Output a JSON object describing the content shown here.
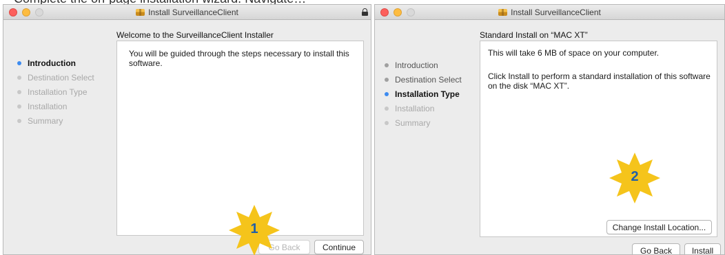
{
  "top_strip_text": "Complete the on-page installation wizard. Navigate…",
  "window1": {
    "title": "Install SurveillanceClient",
    "heading": "Welcome to the SurveillanceClient Installer",
    "steps": [
      {
        "label": "Introduction",
        "state": "active"
      },
      {
        "label": "Destination Select",
        "state": "pending"
      },
      {
        "label": "Installation Type",
        "state": "pending"
      },
      {
        "label": "Installation",
        "state": "pending"
      },
      {
        "label": "Summary",
        "state": "pending"
      }
    ],
    "body": "You will be guided through the steps necessary to install this software.",
    "back_label": "Go Back",
    "continue_label": "Continue",
    "marker": "1"
  },
  "window2": {
    "title": "Install SurveillanceClient",
    "heading": "Standard Install on “MAC XT”",
    "steps": [
      {
        "label": "Introduction",
        "state": "done"
      },
      {
        "label": "Destination Select",
        "state": "done"
      },
      {
        "label": "Installation Type",
        "state": "active"
      },
      {
        "label": "Installation",
        "state": "pending"
      },
      {
        "label": "Summary",
        "state": "pending"
      }
    ],
    "body_line1": "This will take 6 MB of space on your computer.",
    "body_line2": "Click Install to perform a standard installation of this software on the disk “MAC XT”.",
    "change_location_label": "Change Install Location...",
    "back_label": "Go Back",
    "install_label": "Install",
    "marker": "2"
  },
  "colors": {
    "active_step": "#3d8bf0",
    "badge_fill": "#f5c41b",
    "badge_text": "#1f5fa8"
  },
  "icons": [
    "package-icon",
    "lock-icon"
  ]
}
